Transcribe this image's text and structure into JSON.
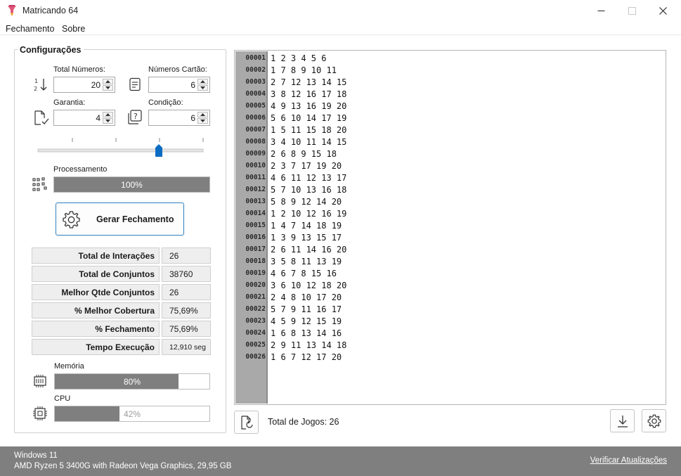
{
  "window": {
    "title": "Matricando 64"
  },
  "menu": {
    "items": [
      {
        "label": "Fechamento"
      },
      {
        "label": "Sobre"
      }
    ]
  },
  "config": {
    "section_title": "Configurações",
    "total_numeros": {
      "label": "Total Números:",
      "value": "20"
    },
    "numeros_cartao": {
      "label": "Números Cartão:",
      "value": "6"
    },
    "garantia": {
      "label": "Garantia:",
      "value": "4"
    },
    "condicao": {
      "label": "Condição:",
      "value": "6"
    },
    "slider": {
      "ticks": 5,
      "selected_index": 3
    }
  },
  "processing": {
    "label": "Processamento",
    "percent": 100,
    "text": "100%"
  },
  "generate_button": {
    "label": "Gerar Fechamento"
  },
  "stats": [
    {
      "label": "Total de Interações",
      "value": "26"
    },
    {
      "label": "Total de Conjuntos",
      "value": "38760"
    },
    {
      "label": "Melhor Qtde Conjuntos",
      "value": "26"
    },
    {
      "label": "% Melhor Cobertura",
      "value": "75,69%"
    },
    {
      "label": "% Fechamento",
      "value": "75,69%"
    },
    {
      "label": "Tempo Execução",
      "value": "12,910 seg"
    }
  ],
  "memory": {
    "label": "Memória",
    "percent": 80,
    "text": "80%"
  },
  "cpu": {
    "label": "CPU",
    "percent": 42,
    "text": "42%"
  },
  "results": {
    "lines": [
      {
        "num": "00001",
        "text": "1 2 3 4 5 6"
      },
      {
        "num": "00002",
        "text": "1 7 8 9 10 11"
      },
      {
        "num": "00003",
        "text": "2 7 12 13 14 15"
      },
      {
        "num": "00004",
        "text": "3 8 12 16 17 18"
      },
      {
        "num": "00005",
        "text": "4 9 13 16 19 20"
      },
      {
        "num": "00006",
        "text": "5 6 10 14 17 19"
      },
      {
        "num": "00007",
        "text": "1 5 11 15 18 20"
      },
      {
        "num": "00008",
        "text": "3 4 10 11 14 15"
      },
      {
        "num": "00009",
        "text": "2 6 8 9 15 18"
      },
      {
        "num": "00010",
        "text": "2 3 7 17 19 20"
      },
      {
        "num": "00011",
        "text": "4 6 11 12 13 17"
      },
      {
        "num": "00012",
        "text": "5 7 10 13 16 18"
      },
      {
        "num": "00013",
        "text": "5 8 9 12 14 20"
      },
      {
        "num": "00014",
        "text": "1 2 10 12 16 19"
      },
      {
        "num": "00015",
        "text": "1 4 7 14 18 19"
      },
      {
        "num": "00016",
        "text": "1 3 9 13 15 17"
      },
      {
        "num": "00017",
        "text": "2 6 11 14 16 20"
      },
      {
        "num": "00018",
        "text": "3 5 8 11 13 19"
      },
      {
        "num": "00019",
        "text": "4 6 7 8 15 16"
      },
      {
        "num": "00020",
        "text": "3 6 10 12 18 20"
      },
      {
        "num": "00021",
        "text": "2 4 8 10 17 20"
      },
      {
        "num": "00022",
        "text": "5 7 9 11 16 17"
      },
      {
        "num": "00023",
        "text": "4 5 9 12 15 19"
      },
      {
        "num": "00024",
        "text": "1 6 8 13 14 16"
      },
      {
        "num": "00025",
        "text": "2 9 11 13 14 18"
      },
      {
        "num": "00026",
        "text": "1 6 7 12 17 20"
      }
    ]
  },
  "footer": {
    "total_jogos": "Total de Jogos: 26"
  },
  "status": {
    "os": "Windows 11",
    "hardware": "AMD Ryzen 5 3400G with Radeon Vega Graphics, 29,95 GB",
    "update_link": "Verificar Atualizações"
  },
  "colors": {
    "accent": "#0b6cc4",
    "progress_fill": "#7f7f7f",
    "statusbar": "#7f7f7f",
    "gutter": "#a9a9a9"
  }
}
